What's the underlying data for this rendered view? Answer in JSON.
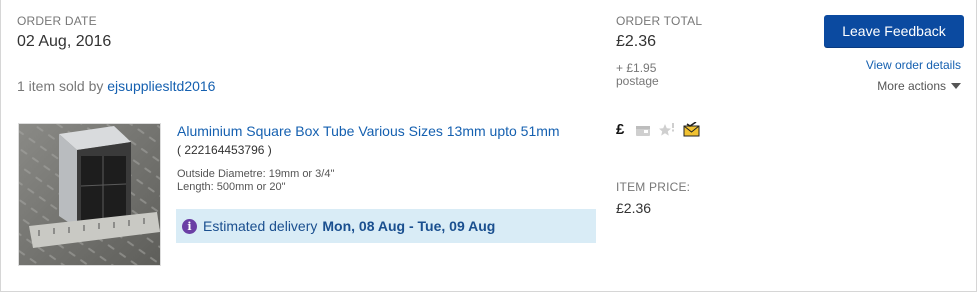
{
  "order": {
    "date_label": "ORDER DATE",
    "date_value": "02 Aug, 2016",
    "total_label": "ORDER TOTAL",
    "total_value": "£2.36",
    "postage_line1": "+ £1.95",
    "postage_line2": "postage",
    "sold_prefix": "1 item sold by",
    "seller": "ejsuppliesltd2016"
  },
  "actions": {
    "leave_feedback": "Leave Feedback",
    "view_order_details": "View order details",
    "more_actions": "More actions"
  },
  "item": {
    "title": "Aluminium Square Box Tube Various Sizes 13mm upto 51mm",
    "item_number": "( 222164453796 )",
    "spec1": "Outside Diametre: 19mm or 3/4\"",
    "spec2": "Length: 500mm or 20\"",
    "delivery_prefix": "Estimated delivery",
    "delivery_range": "Mon, 08 Aug - Tue, 09 Aug",
    "price_label": "ITEM PRICE:",
    "price_value": "£2.36"
  },
  "status_icons": [
    "pound-icon",
    "package-icon",
    "star-icon",
    "envelope-icon"
  ],
  "colors": {
    "primary_button": "#0b4aa0",
    "link": "#1560b0",
    "delivery_bg": "#d9ecf6",
    "info_icon": "#6b3fa5"
  }
}
